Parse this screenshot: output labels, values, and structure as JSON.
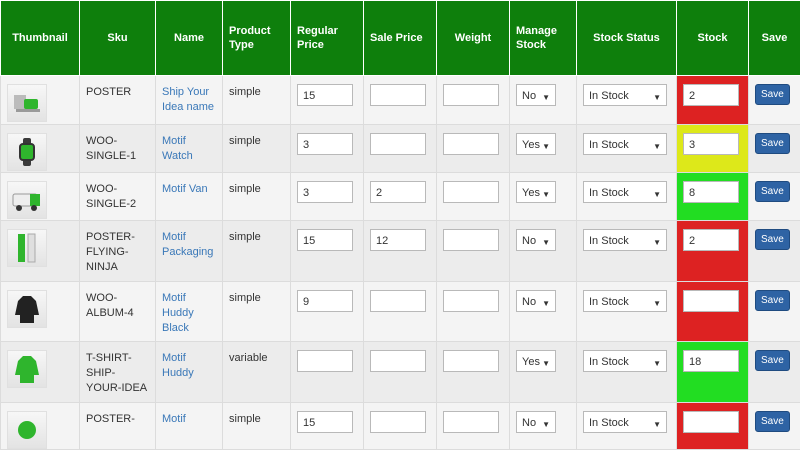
{
  "headers": {
    "thumbnail": "Thumbnail",
    "sku": "Sku",
    "name": "Name",
    "product_type": "Product Type",
    "regular_price": "Regular Price",
    "sale_price": "Sale Price",
    "weight": "Weight",
    "manage_stock": "Manage Stock",
    "stock_status": "Stock Status",
    "stock": "Stock",
    "save": "Save"
  },
  "save_label": "Save",
  "rows": [
    {
      "sku": "POSTER",
      "name": "Ship Your Idea name",
      "type": "simple",
      "regular_price": "15",
      "sale_price": "",
      "weight": "",
      "manage_stock": "No",
      "stock_status": "In Stock",
      "stock": "2",
      "stock_level": "red",
      "thumb_icon": "poster-icon"
    },
    {
      "sku": "WOO-SINGLE-1",
      "name": "Motif Watch",
      "type": "simple",
      "regular_price": "3",
      "sale_price": "",
      "weight": "",
      "manage_stock": "Yes",
      "stock_status": "In Stock",
      "stock": "3",
      "stock_level": "yellow",
      "thumb_icon": "watch-icon"
    },
    {
      "sku": "WOO-SINGLE-2",
      "name": "Motif Van",
      "type": "simple",
      "regular_price": "3",
      "sale_price": "2",
      "weight": "",
      "manage_stock": "Yes",
      "stock_status": "In Stock",
      "stock": "8",
      "stock_level": "green",
      "thumb_icon": "van-icon"
    },
    {
      "sku": "POSTER-FLYING-NINJA",
      "name": "Motif Packaging",
      "type": "simple",
      "regular_price": "15",
      "sale_price": "12",
      "weight": "",
      "manage_stock": "No",
      "stock_status": "In Stock",
      "stock": "2",
      "stock_level": "red",
      "thumb_icon": "packaging-icon"
    },
    {
      "sku": "WOO-ALBUM-4",
      "name": "Motif Huddy Black",
      "type": "simple",
      "regular_price": "9",
      "sale_price": "",
      "weight": "",
      "manage_stock": "No",
      "stock_status": "In Stock",
      "stock": "",
      "stock_level": "red",
      "thumb_icon": "hoodie-black-icon"
    },
    {
      "sku": "T-SHIRT-SHIP-YOUR-IDEA",
      "name": "Motif Huddy",
      "type": "variable",
      "regular_price": "",
      "sale_price": "",
      "weight": "",
      "manage_stock": "Yes",
      "stock_status": "In Stock",
      "stock": "18",
      "stock_level": "green",
      "thumb_icon": "hoodie-green-icon"
    },
    {
      "sku": "POSTER-",
      "name": "Motif",
      "type": "simple",
      "regular_price": "15",
      "sale_price": "",
      "weight": "",
      "manage_stock": "No",
      "stock_status": "In Stock",
      "stock": "",
      "stock_level": "red",
      "thumb_icon": "product-icon"
    }
  ],
  "colors": {
    "header_bg": "#0e7f0c",
    "stock_red": "#dd2222",
    "stock_yellow": "#dde81a",
    "stock_green": "#22dd22",
    "save_button": "#2e63a4",
    "link": "#3a78b8"
  }
}
